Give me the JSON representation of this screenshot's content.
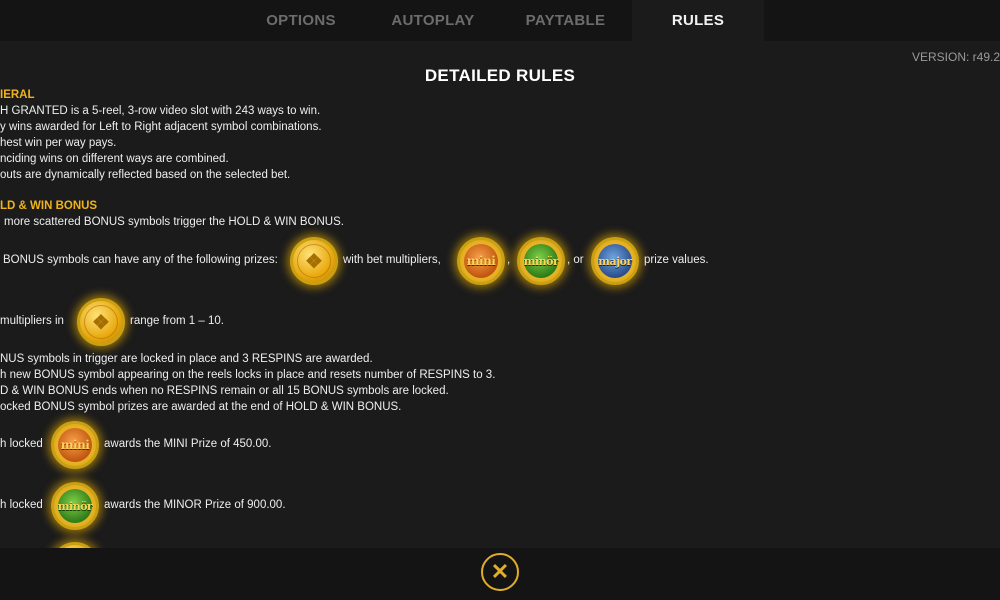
{
  "tabs": [
    {
      "label": "OPTIONS"
    },
    {
      "label": "AUTOPLAY"
    },
    {
      "label": "PAYTABLE"
    },
    {
      "label": "RULES"
    }
  ],
  "active_tab": "RULES",
  "version": "VERSION: r49.2",
  "title": "DETAILED RULES",
  "general": {
    "heading": "IERAL",
    "lines": [
      "H GRANTED is a 5-reel, 3-row video slot with 243 ways to win.",
      "y wins awarded for Left to Right adjacent symbol combinations.",
      "hest win per way pays.",
      "nciding wins on different ways are combined.",
      "outs are dynamically reflected based on the selected bet."
    ]
  },
  "bonus": {
    "heading": "LD & WIN BONUS",
    "line1": "more scattered BONUS symbols trigger the HOLD & WIN BONUS.",
    "prizes_prefix": "BONUS symbols can have any of the following prizes:",
    "prizes_mid": "with bet multipliers,",
    "comma": ",",
    "or": ", or",
    "prizes_suffix": "prize values.",
    "mult_prefix": "multipliers in",
    "mult_suffix": "range from 1 – 10.",
    "rules": [
      "NUS symbols in trigger are locked in place and 3 RESPINS are awarded.",
      "h new BONUS symbol appearing on the reels locks in place and resets number of RESPINS to 3.",
      "D & WIN BONUS ends when no RESPINS remain or all 15 BONUS symbols are locked.",
      "ocked BONUS symbol prizes are awarded at the end of HOLD & WIN BONUS."
    ],
    "mini_prefix": "h locked",
    "mini_text": "awards the MINI Prize of 450.00.",
    "minor_prefix": "h locked",
    "minor_text": "awards the MINOR Prize of 900.00."
  },
  "coins": {
    "gold_icon": "gold-coin-icon",
    "mini_label": "mini",
    "minor_label": "minör",
    "major_label": "major"
  },
  "colors": {
    "background": "#1b1b1b",
    "tabbar": "#141414",
    "heading_accent": "#f0b31c",
    "close_accent": "#e0ad2c"
  },
  "close_button": {
    "icon": "close-icon",
    "glyph": "✕"
  }
}
